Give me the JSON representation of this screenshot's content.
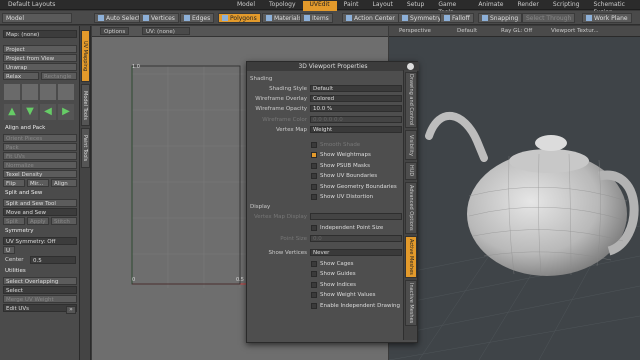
{
  "menubar": {
    "layout": "Default Layouts",
    "menus": [
      "Model",
      "Topology",
      "UVEdit",
      "Paint",
      "Layout",
      "Setup",
      "Game Tools",
      "Animate",
      "Render",
      "Scripting",
      "Schematic Fusion"
    ],
    "active": "UVEdit"
  },
  "toolbar": {
    "model": "Model",
    "auto_select": "Auto Select",
    "vertices": "Vertices",
    "edges": "Edges",
    "polygons": "Polygons",
    "materials": "Materials",
    "items": "Items",
    "action_center": "Action Center",
    "symmetry": "Symmetry",
    "falloff": "Falloff",
    "snapping": "Snapping",
    "select_through": "Select Through",
    "work_plane": "Work Plane"
  },
  "leftpanel": {
    "map": "Map: (none)",
    "project": "Project",
    "project_view": "Project from View",
    "unwrap": "Unwrap",
    "relax": "Relax",
    "rectangle": "Rectangle",
    "align_pack": "Align and Pack",
    "orient_pieces": "Orient Pieces",
    "pack": "Pack",
    "fit_uvs": "Fit UVs",
    "normalize": "Normalize",
    "texel_density": "Texel Density",
    "flip": "Flip",
    "mirror": "Mir...",
    "align": "Align",
    "split_sew": "Split and Sew",
    "split_sew_tool": "Split and Sew Tool",
    "move_sew": "Move and Sew",
    "split": "Split",
    "apply": "Apply",
    "stitch": "Stitch",
    "symmetry": "Symmetry",
    "uv_symmetry": "UV Symmetry: Off",
    "axis": "U",
    "center_label": "Center",
    "center_val": "0.5",
    "utilities": "Utilities",
    "select_overlap": "Select Overlapping Polyg...",
    "select": "Select",
    "merge_weight": "Merge UV Weight",
    "edit_uvs": "Edit UVs"
  },
  "sidetabs": [
    "UV Mapping",
    "Model Tools",
    "Paint Tools"
  ],
  "uvview": {
    "options": "Options",
    "uvmap": "UV: (none)",
    "tick_10": "1.0",
    "tick_0": "0",
    "tick_05": "0.5"
  },
  "viewport3d": {
    "perspective": "Perspective",
    "default": "Default",
    "raygl": "Ray GL: Off",
    "texture": "Viewport Textur..."
  },
  "props": {
    "title": "3D Viewport Properties",
    "shading": "Shading",
    "shading_style_label": "Shading Style",
    "shading_style": "Default",
    "wire_overlay_label": "Wireframe Overlay",
    "wire_overlay": "Colored",
    "wire_opacity_label": "Wireframe Opacity",
    "wire_opacity": "10.0 %",
    "wire_color_label": "Wireframe Color",
    "wire_color_vals": "0.0      0.0      0.0",
    "vertex_map_label": "Vertex Map",
    "vertex_map": "Weight",
    "smooth_shade": "Smooth Shade",
    "show_weightmaps": "Show Weightmaps",
    "show_psub": "Show PSUB Masks",
    "show_uv_bound": "Show UV Boundaries",
    "show_geo_bound": "Show Geometry Boundaries",
    "show_uv_dist": "Show UV Distortion",
    "display": "Display",
    "vmap_display_label": "Vertex Map Display",
    "indep_point": "Independent Point Size",
    "point_size_label": "Point Size",
    "point_size": "0.0",
    "show_vertices_label": "Show Vertices",
    "show_vertices": "Never",
    "show_cages": "Show Cages",
    "show_guides": "Show Guides",
    "show_indices": "Show Indices",
    "show_weight_vals": "Show Weight Values",
    "enable_indep": "Enable Independent Drawing",
    "tabs": [
      "Drawing and Control",
      "Visibility",
      "HUD",
      "Advanced Options",
      "Active Meshes",
      "Inactive Meshes"
    ],
    "active_tab": "Active Meshes"
  },
  "colors": {
    "accent": "#e39a2b"
  }
}
